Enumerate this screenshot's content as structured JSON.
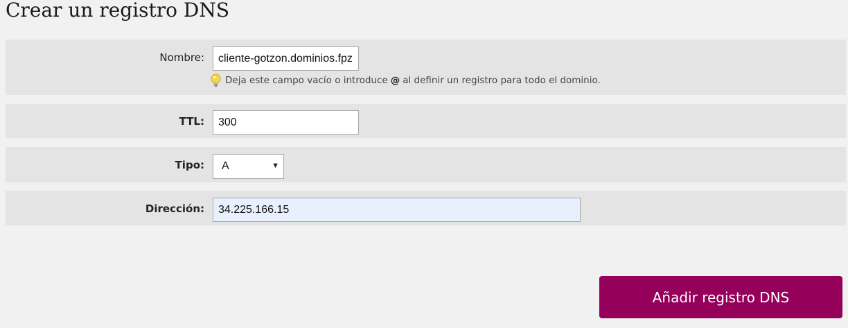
{
  "page": {
    "title": "Crear un registro DNS"
  },
  "form": {
    "nombre": {
      "label": "Nombre:",
      "value": "cliente-gotzon.dominios.fpz",
      "hint_before": "Deja este campo vacío o introduce",
      "hint_symbol": "@",
      "hint_after": "al definir un registro para todo el dominio."
    },
    "ttl": {
      "label": "TTL:",
      "value": "300"
    },
    "tipo": {
      "label": "Tipo:",
      "selected": "A"
    },
    "direccion": {
      "label": "Dirección:",
      "value": "34.225.166.15"
    },
    "submit_label": "Añadir registro DNS"
  },
  "icons": {
    "hint_icon": "lightbulb-icon",
    "select_arrow": "dropdown-arrow-icon"
  },
  "colors": {
    "button_bg": "#95005b",
    "row_bg": "#e4e4e4",
    "page_bg": "#f1f1f1",
    "autofill_bg": "#e8f0fe"
  }
}
